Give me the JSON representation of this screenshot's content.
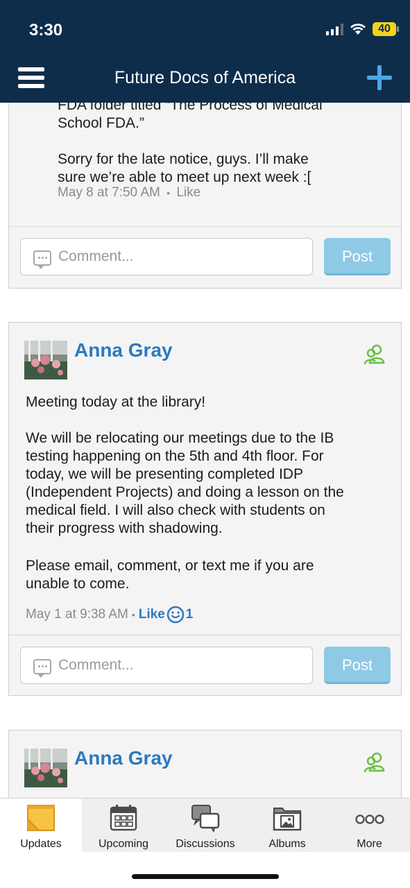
{
  "status_bar": {
    "time": "3:30",
    "battery": "40"
  },
  "nav": {
    "title": "Future Docs of America"
  },
  "post1": {
    "text_line1": "FDA folder titled “The Process of Medical",
    "text_line2": "School FDA.”",
    "text_para2_line1": "Sorry for the late notice, guys. I’ll make",
    "text_para2_line2": "sure we’re able to meet up next week :[",
    "meta_time": "May 8 at 7:50 AM",
    "meta_sep": "•",
    "meta_like": "Like",
    "comment_placeholder": "Comment...",
    "post_label": "Post"
  },
  "post2": {
    "author": "Anna Gray",
    "title": "Meeting today at the library!",
    "body_lines": [
      "We will be relocating our meetings due to the IB",
      "testing happening on the 5th and 4th floor. For",
      "today, we will be presenting completed IDP",
      "(Independent Projects) and doing a lesson on the",
      "medical field. I will also check with students on",
      "their progress with shadowing."
    ],
    "closing_line1": "Please email, comment, or text me if you are",
    "closing_line2": "unable to come.",
    "meta_time": "May 1 at 9:38 AM",
    "meta_sep": "•",
    "meta_like": "Like",
    "like_count": "1",
    "comment_placeholder": "Comment...",
    "post_label": "Post"
  },
  "post3": {
    "author": "Anna Gray"
  },
  "tabs": [
    {
      "label": "Updates",
      "icon": "updates-icon"
    },
    {
      "label": "Upcoming",
      "icon": "calendar-icon"
    },
    {
      "label": "Discussions",
      "icon": "discussions-icon"
    },
    {
      "label": "Albums",
      "icon": "albums-icon"
    },
    {
      "label": "More",
      "icon": "more-icon"
    }
  ],
  "colors": {
    "nav_bg": "#0e2d4b",
    "accent": "#2a7ac0",
    "post_button": "#8ecae6",
    "member_icon": "#6abf45"
  }
}
